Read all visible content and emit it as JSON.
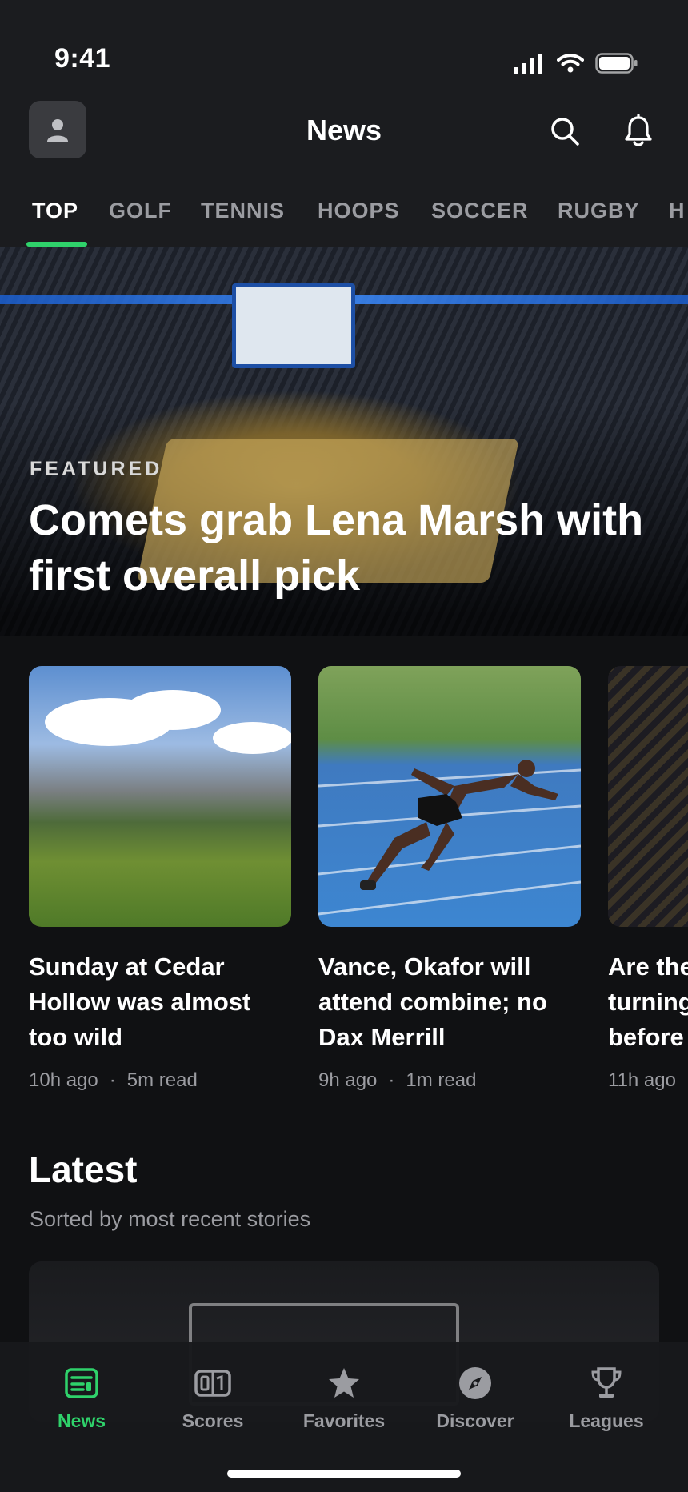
{
  "status_bar": {
    "time": "9:41"
  },
  "header": {
    "title": "News"
  },
  "tabs": [
    "TOP",
    "GOLF",
    "TENNIS",
    "HOOPS",
    "SOCCER",
    "RUGBY",
    "H"
  ],
  "hero": {
    "label": "FEATURED",
    "title": "Comets grab Lena Marsh with first overall pick"
  },
  "cards": [
    {
      "title": [
        "Sunday at Cedar",
        "Hollow was almost",
        "too wild"
      ],
      "age": "10h ago",
      "read": "5m read"
    },
    {
      "title": [
        "Vance, Okafor will",
        "attend combine; no",
        "Dax Merrill"
      ],
      "age": "9h ago",
      "read": "1m read"
    },
    {
      "title": [
        "Are the",
        "turning",
        "before"
      ],
      "age": "11h ago",
      "read": ""
    }
  ],
  "latest": {
    "heading": "Latest",
    "subtitle": "Sorted by most recent stories"
  },
  "tabbar": [
    {
      "label": "News",
      "icon": "newspaper-icon"
    },
    {
      "label": "Scores",
      "icon": "scoreboard-icon"
    },
    {
      "label": "Favorites",
      "icon": "star-icon"
    },
    {
      "label": "Discover",
      "icon": "compass-icon"
    },
    {
      "label": "Leagues",
      "icon": "trophy-icon"
    }
  ],
  "colors": {
    "accent": "#2fd26b",
    "background": "#101113",
    "header": "#1b1c1f",
    "muted": "#9b9ca1"
  }
}
